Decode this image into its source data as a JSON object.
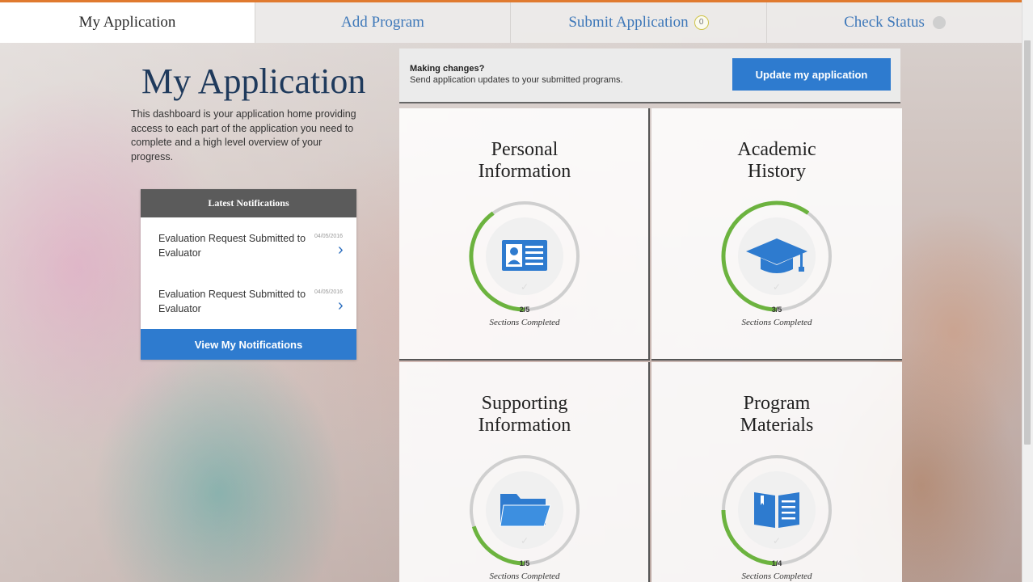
{
  "tabs": [
    {
      "label": "My Application"
    },
    {
      "label": "Add Program"
    },
    {
      "label": "Submit Application",
      "badge": "0"
    },
    {
      "label": "Check Status"
    }
  ],
  "page": {
    "title": "My Application",
    "intro": "This dashboard is your application home providing access to each part of the application you need to complete and a high level overview of your progress."
  },
  "notifications": {
    "header": "Latest Notifications",
    "items": [
      {
        "text": "Evaluation Request Submitted to Evaluator",
        "date": "04/05/2016"
      },
      {
        "text": "Evaluation Request Submitted to Evaluator",
        "date": "04/05/2016"
      }
    ],
    "view_all_label": "View My Notifications"
  },
  "changes_banner": {
    "title": "Making changes?",
    "subtitle": "Send application updates to your submitted programs.",
    "button_label": "Update my application"
  },
  "sections": [
    {
      "title_line1": "Personal",
      "title_line2": "Information",
      "icon": "id-card-icon",
      "completed": 2,
      "total": 5,
      "count": "2/5",
      "label": "Sections Completed"
    },
    {
      "title_line1": "Academic",
      "title_line2": "History",
      "icon": "graduation-cap-icon",
      "completed": 3,
      "total": 5,
      "count": "3/5",
      "label": "Sections Completed"
    },
    {
      "title_line1": "Supporting",
      "title_line2": "Information",
      "icon": "folder-icon",
      "completed": 1,
      "total": 5,
      "count": "1/5",
      "label": "Sections Completed"
    },
    {
      "title_line1": "Program",
      "title_line2": "Materials",
      "icon": "book-icon",
      "completed": 1,
      "total": 4,
      "count": "1/4",
      "label": "Sections Completed"
    }
  ],
  "colors": {
    "accent_blue": "#2e7bcf",
    "progress_green": "#6cb33f",
    "ring_gray": "#cfcfcf",
    "top_line": "#e07a2f"
  }
}
